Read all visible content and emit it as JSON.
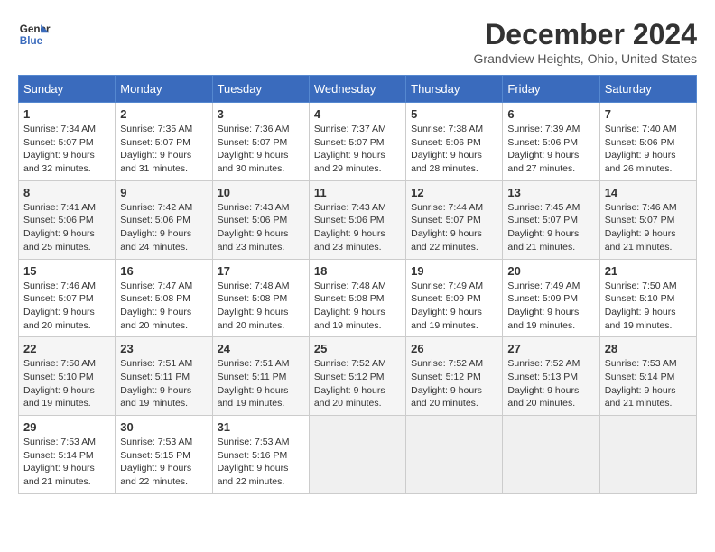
{
  "logo": {
    "line1": "General",
    "line2": "Blue"
  },
  "title": "December 2024",
  "location": "Grandview Heights, Ohio, United States",
  "headers": [
    "Sunday",
    "Monday",
    "Tuesday",
    "Wednesday",
    "Thursday",
    "Friday",
    "Saturday"
  ],
  "weeks": [
    [
      {
        "day": "1",
        "sunrise": "7:34 AM",
        "sunset": "5:07 PM",
        "daylight": "9 hours and 32 minutes."
      },
      {
        "day": "2",
        "sunrise": "7:35 AM",
        "sunset": "5:07 PM",
        "daylight": "9 hours and 31 minutes."
      },
      {
        "day": "3",
        "sunrise": "7:36 AM",
        "sunset": "5:07 PM",
        "daylight": "9 hours and 30 minutes."
      },
      {
        "day": "4",
        "sunrise": "7:37 AM",
        "sunset": "5:07 PM",
        "daylight": "9 hours and 29 minutes."
      },
      {
        "day": "5",
        "sunrise": "7:38 AM",
        "sunset": "5:06 PM",
        "daylight": "9 hours and 28 minutes."
      },
      {
        "day": "6",
        "sunrise": "7:39 AM",
        "sunset": "5:06 PM",
        "daylight": "9 hours and 27 minutes."
      },
      {
        "day": "7",
        "sunrise": "7:40 AM",
        "sunset": "5:06 PM",
        "daylight": "9 hours and 26 minutes."
      }
    ],
    [
      {
        "day": "8",
        "sunrise": "7:41 AM",
        "sunset": "5:06 PM",
        "daylight": "9 hours and 25 minutes."
      },
      {
        "day": "9",
        "sunrise": "7:42 AM",
        "sunset": "5:06 PM",
        "daylight": "9 hours and 24 minutes."
      },
      {
        "day": "10",
        "sunrise": "7:43 AM",
        "sunset": "5:06 PM",
        "daylight": "9 hours and 23 minutes."
      },
      {
        "day": "11",
        "sunrise": "7:43 AM",
        "sunset": "5:06 PM",
        "daylight": "9 hours and 23 minutes."
      },
      {
        "day": "12",
        "sunrise": "7:44 AM",
        "sunset": "5:07 PM",
        "daylight": "9 hours and 22 minutes."
      },
      {
        "day": "13",
        "sunrise": "7:45 AM",
        "sunset": "5:07 PM",
        "daylight": "9 hours and 21 minutes."
      },
      {
        "day": "14",
        "sunrise": "7:46 AM",
        "sunset": "5:07 PM",
        "daylight": "9 hours and 21 minutes."
      }
    ],
    [
      {
        "day": "15",
        "sunrise": "7:46 AM",
        "sunset": "5:07 PM",
        "daylight": "9 hours and 20 minutes."
      },
      {
        "day": "16",
        "sunrise": "7:47 AM",
        "sunset": "5:08 PM",
        "daylight": "9 hours and 20 minutes."
      },
      {
        "day": "17",
        "sunrise": "7:48 AM",
        "sunset": "5:08 PM",
        "daylight": "9 hours and 20 minutes."
      },
      {
        "day": "18",
        "sunrise": "7:48 AM",
        "sunset": "5:08 PM",
        "daylight": "9 hours and 19 minutes."
      },
      {
        "day": "19",
        "sunrise": "7:49 AM",
        "sunset": "5:09 PM",
        "daylight": "9 hours and 19 minutes."
      },
      {
        "day": "20",
        "sunrise": "7:49 AM",
        "sunset": "5:09 PM",
        "daylight": "9 hours and 19 minutes."
      },
      {
        "day": "21",
        "sunrise": "7:50 AM",
        "sunset": "5:10 PM",
        "daylight": "9 hours and 19 minutes."
      }
    ],
    [
      {
        "day": "22",
        "sunrise": "7:50 AM",
        "sunset": "5:10 PM",
        "daylight": "9 hours and 19 minutes."
      },
      {
        "day": "23",
        "sunrise": "7:51 AM",
        "sunset": "5:11 PM",
        "daylight": "9 hours and 19 minutes."
      },
      {
        "day": "24",
        "sunrise": "7:51 AM",
        "sunset": "5:11 PM",
        "daylight": "9 hours and 19 minutes."
      },
      {
        "day": "25",
        "sunrise": "7:52 AM",
        "sunset": "5:12 PM",
        "daylight": "9 hours and 20 minutes."
      },
      {
        "day": "26",
        "sunrise": "7:52 AM",
        "sunset": "5:12 PM",
        "daylight": "9 hours and 20 minutes."
      },
      {
        "day": "27",
        "sunrise": "7:52 AM",
        "sunset": "5:13 PM",
        "daylight": "9 hours and 20 minutes."
      },
      {
        "day": "28",
        "sunrise": "7:53 AM",
        "sunset": "5:14 PM",
        "daylight": "9 hours and 21 minutes."
      }
    ],
    [
      {
        "day": "29",
        "sunrise": "7:53 AM",
        "sunset": "5:14 PM",
        "daylight": "9 hours and 21 minutes."
      },
      {
        "day": "30",
        "sunrise": "7:53 AM",
        "sunset": "5:15 PM",
        "daylight": "9 hours and 22 minutes."
      },
      {
        "day": "31",
        "sunrise": "7:53 AM",
        "sunset": "5:16 PM",
        "daylight": "9 hours and 22 minutes."
      },
      null,
      null,
      null,
      null
    ]
  ]
}
